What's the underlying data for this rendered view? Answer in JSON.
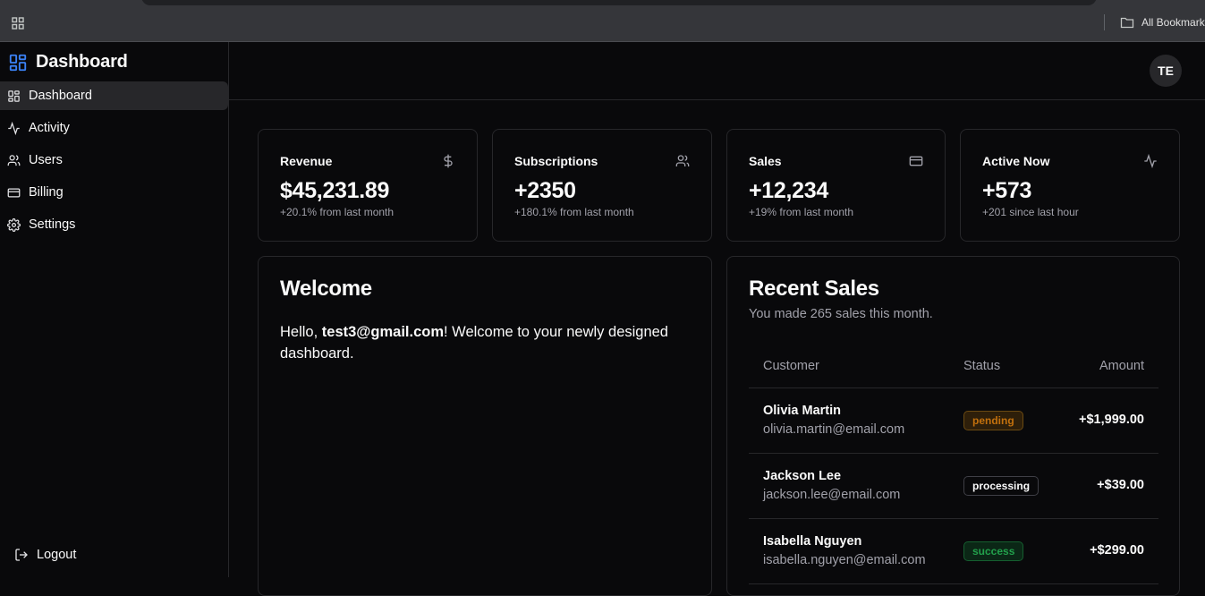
{
  "browser": {
    "bookmarks_label": "All Bookmarks"
  },
  "sidebar": {
    "brand": "Dashboard",
    "items": [
      {
        "label": "Dashboard",
        "icon": "layout-grid-icon",
        "active": true
      },
      {
        "label": "Activity",
        "icon": "activity-icon"
      },
      {
        "label": "Users",
        "icon": "users-icon"
      },
      {
        "label": "Billing",
        "icon": "credit-card-icon"
      },
      {
        "label": "Settings",
        "icon": "gear-icon"
      }
    ],
    "logout": "Logout"
  },
  "header": {
    "avatar_initials": "TE"
  },
  "stats": [
    {
      "label": "Revenue",
      "value": "$45,231.89",
      "sub": "+20.1% from last month",
      "icon": "dollar-icon"
    },
    {
      "label": "Subscriptions",
      "value": "+2350",
      "sub": "+180.1% from last month",
      "icon": "users-icon"
    },
    {
      "label": "Sales",
      "value": "+12,234",
      "sub": "+19% from last month",
      "icon": "credit-card-icon"
    },
    {
      "label": "Active Now",
      "value": "+573",
      "sub": "+201 since last hour",
      "icon": "activity-icon"
    }
  ],
  "welcome": {
    "title": "Welcome",
    "greeting": "Hello, ",
    "email": "test3@gmail.com",
    "message": "! Welcome to your newly designed dashboard."
  },
  "recent_sales": {
    "title": "Recent Sales",
    "description": "You made 265 sales this month.",
    "columns": {
      "customer": "Customer",
      "status": "Status",
      "amount": "Amount"
    },
    "rows": [
      {
        "name": "Olivia Martin",
        "email": "olivia.martin@email.com",
        "status": "pending",
        "amount": "+$1,999.00"
      },
      {
        "name": "Jackson Lee",
        "email": "jackson.lee@email.com",
        "status": "processing",
        "amount": "+$39.00"
      },
      {
        "name": "Isabella Nguyen",
        "email": "isabella.nguyen@email.com",
        "status": "success",
        "amount": "+$299.00"
      }
    ]
  },
  "colors": {
    "background": "#09090b",
    "border": "#27272a",
    "brand_accent": "#3b82f6",
    "pending": "#c2700d",
    "success": "#22a04b"
  }
}
